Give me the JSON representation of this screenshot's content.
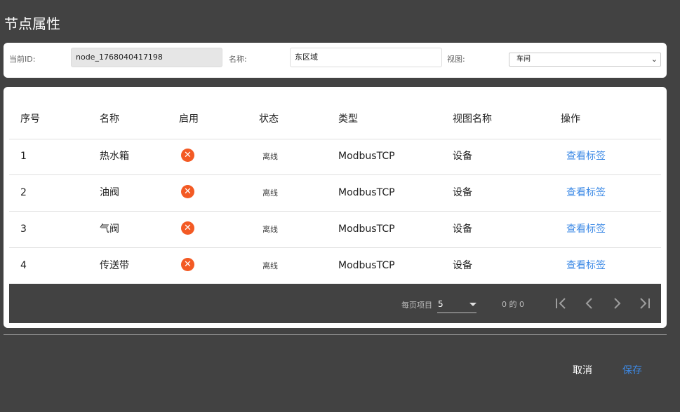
{
  "page": {
    "title": "节点属性"
  },
  "form": {
    "id_label": "当前ID:",
    "id_value": "node_1768040417198",
    "name_label": "名称:",
    "name_value": "东区域",
    "view_label": "视图:",
    "view_value": "车间"
  },
  "table": {
    "headers": {
      "index": "序号",
      "name": "名称",
      "enabled": "启用",
      "status": "状态",
      "type": "类型",
      "view_name": "视图名称",
      "action": "操作"
    },
    "rows": [
      {
        "index": "1",
        "name": "热水箱",
        "enabled_icon": "error-circle-icon",
        "status": "离线",
        "type": "ModbusTCP",
        "view_name": "设备",
        "action": "查看标签"
      },
      {
        "index": "2",
        "name": "油阀",
        "enabled_icon": "error-circle-icon",
        "status": "离线",
        "type": "ModbusTCP",
        "view_name": "设备",
        "action": "查看标签"
      },
      {
        "index": "3",
        "name": "气阀",
        "enabled_icon": "error-circle-icon",
        "status": "离线",
        "type": "ModbusTCP",
        "view_name": "设备",
        "action": "查看标签"
      },
      {
        "index": "4",
        "name": "传送带",
        "enabled_icon": "error-circle-icon",
        "status": "离线",
        "type": "ModbusTCP",
        "view_name": "设备",
        "action": "查看标签"
      }
    ]
  },
  "pagination": {
    "items_per_page_label": "每页项目",
    "items_per_page_value": "5",
    "range_text": "0 的 0"
  },
  "footer": {
    "cancel_label": "取消",
    "save_label": "保存"
  },
  "colors": {
    "background": "#424242",
    "accent": "#3d8ae6",
    "error": "#f35a24"
  }
}
